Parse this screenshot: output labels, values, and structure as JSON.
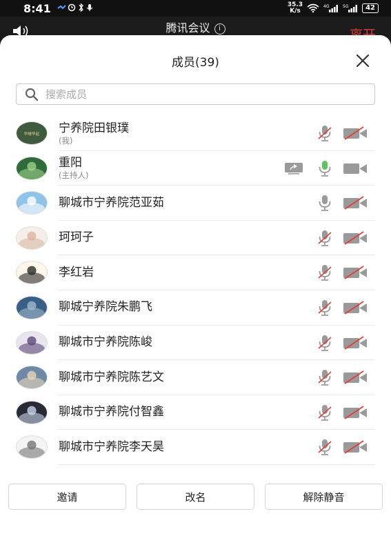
{
  "status_bar": {
    "time": "8:41",
    "net_speed_value": "35.3",
    "net_speed_unit": "K/s",
    "battery": "42"
  },
  "meeting": {
    "title": "腾讯会议",
    "leave_label": "离开"
  },
  "members_sheet": {
    "title": "成员(39)",
    "search_placeholder": "搜索成员"
  },
  "members": [
    {
      "name": "宁养院田银璞",
      "role": "(我)",
      "mic": "muted",
      "camera": "off",
      "sharing": false
    },
    {
      "name": "重阳",
      "role": "(主持人)",
      "mic": "on",
      "camera": "on",
      "sharing": true
    },
    {
      "name": "聊城市宁养院范亚茹",
      "role": "",
      "mic": "available",
      "camera": "off",
      "sharing": false
    },
    {
      "name": "珂珂子",
      "role": "",
      "mic": "muted",
      "camera": "off",
      "sharing": false
    },
    {
      "name": "李红岩",
      "role": "",
      "mic": "muted",
      "camera": "off",
      "sharing": false
    },
    {
      "name": "聊城宁养院朱鹏飞",
      "role": "",
      "mic": "muted",
      "camera": "off",
      "sharing": false
    },
    {
      "name": "聊城市宁养院陈峻",
      "role": "",
      "mic": "muted",
      "camera": "off",
      "sharing": false
    },
    {
      "name": "聊城市宁养院陈艺文",
      "role": "",
      "mic": "muted",
      "camera": "off",
      "sharing": false
    },
    {
      "name": "聊城市宁养院付智鑫",
      "role": "",
      "mic": "muted",
      "camera": "off",
      "sharing": false
    },
    {
      "name": "聊城市宁养院李天昊",
      "role": "",
      "mic": "muted",
      "camera": "off",
      "sharing": false
    }
  ],
  "avatar_styles": [
    {
      "bg": "#3f5a3c",
      "fg": "#d9c99a",
      "text": "早睡早起"
    },
    {
      "bg": "#2f6b3a",
      "fg": "#9bd08a",
      "text": ""
    },
    {
      "bg": "#8fc3e8",
      "fg": "#ffffff",
      "text": ""
    },
    {
      "bg": "#f6efe9",
      "fg": "#d9b7a0",
      "text": ""
    },
    {
      "bg": "#fff7ea",
      "fg": "#2b2b2b",
      "text": ""
    },
    {
      "bg": "#3a5f86",
      "fg": "#9fb8c9",
      "text": ""
    },
    {
      "bg": "#e9e4ef",
      "fg": "#5b4a7a",
      "text": ""
    },
    {
      "bg": "#6e89a8",
      "fg": "#e7d6b8",
      "text": ""
    },
    {
      "bg": "#2a2a35",
      "fg": "#c8d3ea",
      "text": ""
    },
    {
      "bg": "#f4f4f4",
      "fg": "#777777",
      "text": ""
    }
  ],
  "buttons": {
    "invite": "邀请",
    "rename": "改名",
    "unmute_all": "解除静音"
  },
  "colors": {
    "mute_red": "#e0403a",
    "icon_gray": "#9a9a9a",
    "mic_on_green": "#5dc55d",
    "leave_red": "#e03b3b"
  }
}
